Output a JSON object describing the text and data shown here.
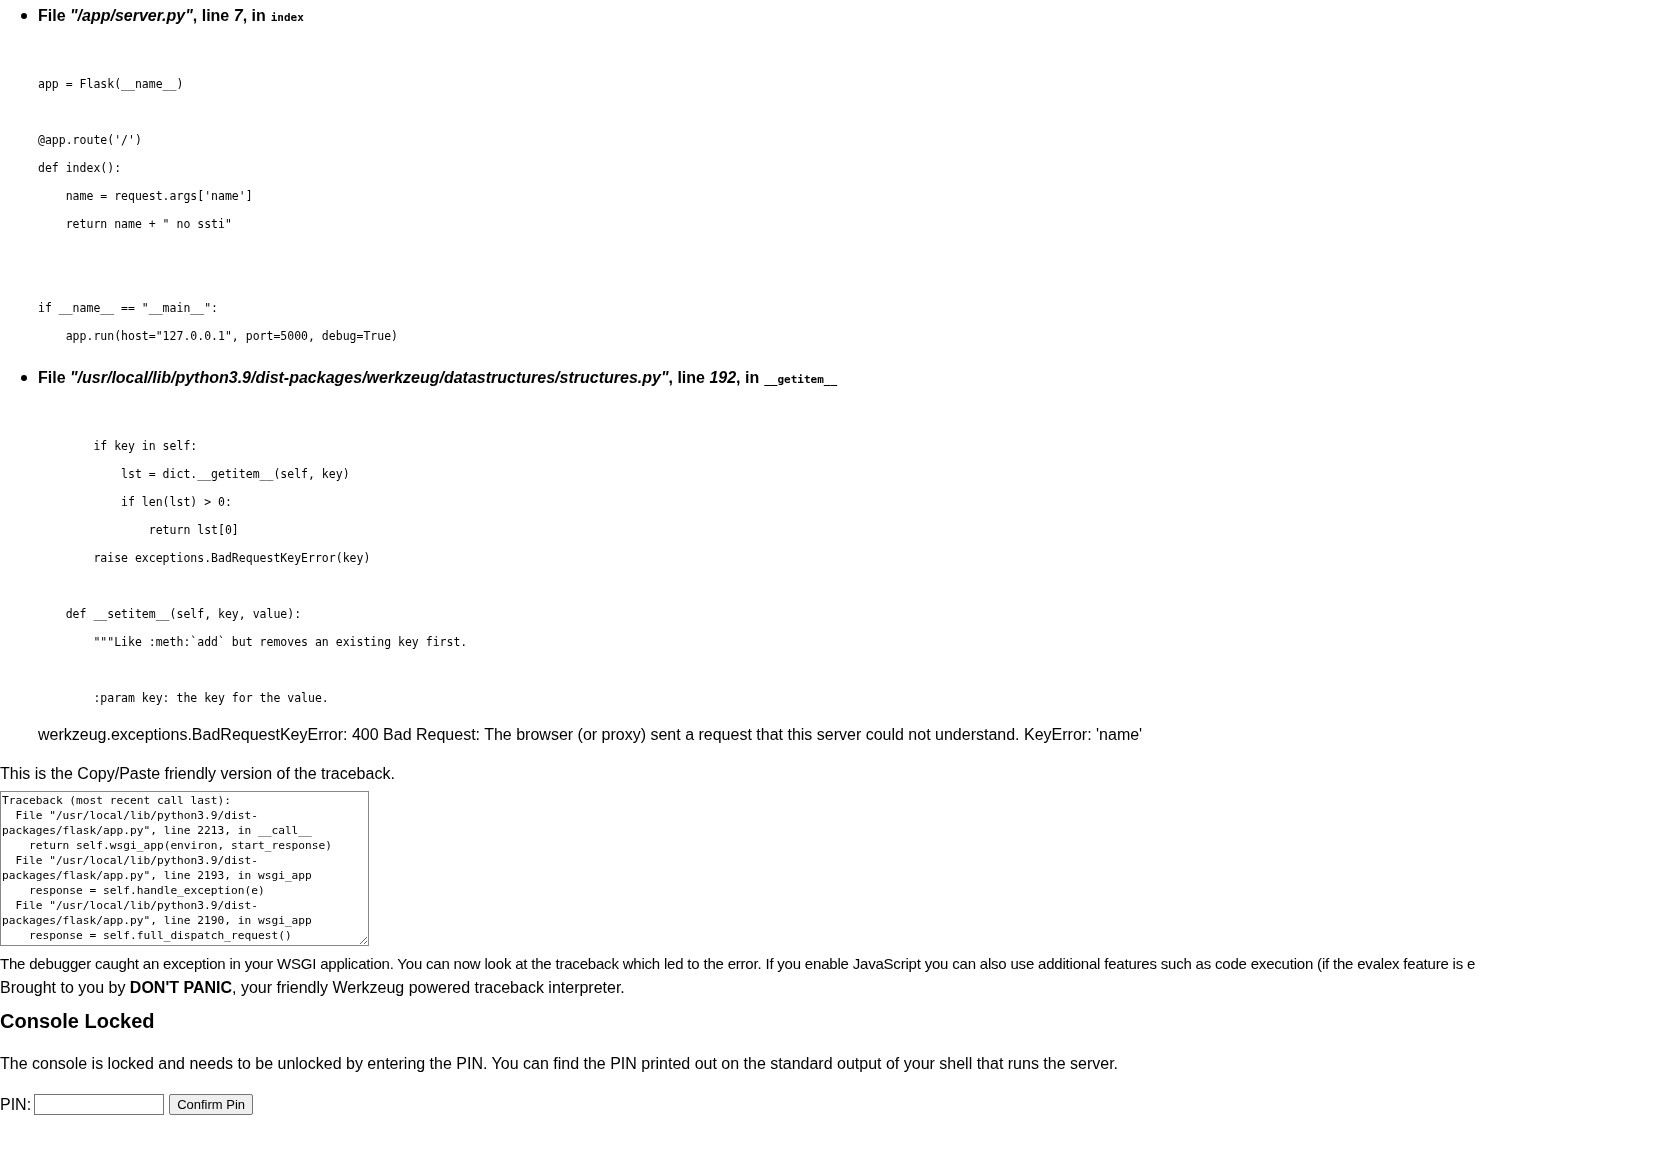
{
  "frames": [
    {
      "heading": "File *\"/app/server.py\"*, line *7*, in",
      "function": "index",
      "code": [
        {
          "kind": "code",
          "text": "app = Flask(__name__)"
        },
        {
          "kind": "blank"
        },
        {
          "kind": "code",
          "text": "@app.route('/')"
        },
        {
          "kind": "code",
          "text": "def index():"
        },
        {
          "kind": "code",
          "text": "    name = request.args['name']"
        },
        {
          "kind": "code",
          "text": "    return name + \" no ssti\""
        },
        {
          "kind": "blank"
        },
        {
          "kind": "blank"
        },
        {
          "kind": "code",
          "text": "if __name__ == \"__main__\":"
        },
        {
          "kind": "code",
          "text": "    app.run(host=\"127.0.0.1\", port=5000, debug=True)"
        }
      ]
    },
    {
      "heading": "File *\"/usr/local/lib/python3.9/dist-packages/werkzeug/datastructures/structures.py\"*, line *192*, in",
      "function": "__getitem__",
      "code": [
        {
          "kind": "code",
          "text": "        if key in self:"
        },
        {
          "kind": "code",
          "text": "            lst = dict.__getitem__(self, key)"
        },
        {
          "kind": "code",
          "text": "            if len(lst) > 0:"
        },
        {
          "kind": "code",
          "text": "                return lst[0]"
        },
        {
          "kind": "code",
          "text": "        raise exceptions.BadRequestKeyError(key)"
        },
        {
          "kind": "blank"
        },
        {
          "kind": "code",
          "text": "    def __setitem__(self, key, value):"
        },
        {
          "kind": "code",
          "text": "        \"\"\"Like :meth:`add` but removes an existing key first."
        },
        {
          "kind": "blank"
        },
        {
          "kind": "code",
          "text": "        :param key: the key for the value."
        }
      ]
    }
  ],
  "exception": "werkzeug.exceptions.BadRequestKeyError: 400 Bad Request: The browser (or proxy) sent a request that this server could not understand. KeyError: 'name'",
  "copy_note": "This is the Copy/Paste friendly version of the traceback.",
  "traceback_lines": [
    "Traceback (most recent call last):",
    "  File \"/usr/local/lib/python3.9/dist-",
    "packages/flask/app.py\", line 2213, in __call__",
    "    return self.wsgi_app(environ, start_response)",
    "  File \"/usr/local/lib/python3.9/dist-",
    "packages/flask/app.py\", line 2193, in wsgi_app",
    "    response = self.handle_exception(e)",
    "  File \"/usr/local/lib/python3.9/dist-",
    "packages/flask/app.py\", line 2190, in wsgi_app",
    "    response = self.full_dispatch_request()"
  ],
  "explanation": "The debugger caught an exception in your WSGI application. You can now look at the traceback which led to the error. If you enable JavaScript you can also use additional features such as code execution (if the evalex feature is e",
  "footer": "Brought to you by **DON'T PANIC**, your friendly Werkzeug powered traceback interpreter.",
  "console": {
    "title": "Console Locked",
    "message": "The console is locked and needs to be unlocked by entering the PIN. You can find the PIN printed out on the standard output of your shell that runs the server.",
    "pin_label": "PIN:",
    "button": "Confirm Pin"
  }
}
